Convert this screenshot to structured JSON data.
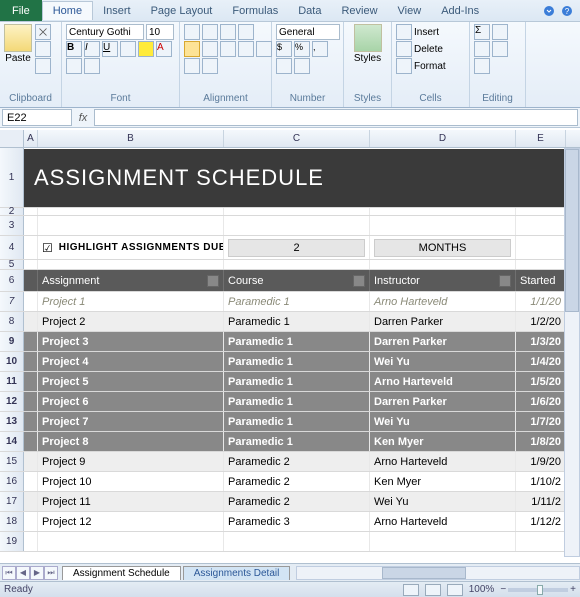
{
  "ribbon": {
    "file": "File",
    "tabs": [
      "Home",
      "Insert",
      "Page Layout",
      "Formulas",
      "Data",
      "Review",
      "View",
      "Add-Ins"
    ],
    "active_tab": "Home",
    "clipboard": {
      "label": "Clipboard",
      "paste": "Paste"
    },
    "font": {
      "label": "Font",
      "name": "Century Gothi",
      "size": "10"
    },
    "alignment": {
      "label": "Alignment"
    },
    "number": {
      "label": "Number",
      "format": "General"
    },
    "styles": {
      "label": "Styles"
    },
    "cells": {
      "label": "Cells",
      "insert": "Insert",
      "delete": "Delete",
      "format": "Format"
    },
    "editing": {
      "label": "Editing"
    }
  },
  "namebox": "E22",
  "fx": "fx",
  "columns": [
    "A",
    "B",
    "C",
    "D",
    "E"
  ],
  "row_numbers": [
    "1",
    "2",
    "3",
    "4",
    "5",
    "6",
    "7",
    "8",
    "9",
    "10",
    "11",
    "12",
    "13",
    "14",
    "15",
    "16",
    "17",
    "18",
    "19"
  ],
  "title": "ASSIGNMENT SCHEDULE",
  "highlight": {
    "checked": true,
    "label": "HIGHLIGHT ASSIGNMENTS DUE WITHIN",
    "value": "2",
    "unit": "MONTHS"
  },
  "table": {
    "headers": [
      "Assignment",
      "Course",
      "Instructor",
      "Started"
    ],
    "rows": [
      {
        "cells": [
          "Project 1",
          "Paramedic 1",
          "Arno Harteveld",
          "1/1/20"
        ],
        "style": "italic"
      },
      {
        "cells": [
          "Project 2",
          "Paramedic 1",
          "Darren Parker",
          "1/2/20"
        ],
        "style": "light"
      },
      {
        "cells": [
          "Project 3",
          "Paramedic 1",
          "Darren Parker",
          "1/3/20"
        ],
        "style": "gray"
      },
      {
        "cells": [
          "Project 4",
          "Paramedic 1",
          "Wei Yu",
          "1/4/20"
        ],
        "style": "gray"
      },
      {
        "cells": [
          "Project 5",
          "Paramedic 1",
          "Arno Harteveld",
          "1/5/20"
        ],
        "style": "gray"
      },
      {
        "cells": [
          "Project 6",
          "Paramedic 1",
          "Darren Parker",
          "1/6/20"
        ],
        "style": "gray"
      },
      {
        "cells": [
          "Project 7",
          "Paramedic 1",
          "Wei Yu",
          "1/7/20"
        ],
        "style": "gray"
      },
      {
        "cells": [
          "Project 8",
          "Paramedic 1",
          "Ken Myer",
          "1/8/20"
        ],
        "style": "gray"
      },
      {
        "cells": [
          "Project 9",
          "Paramedic 2",
          "Arno Harteveld",
          "1/9/20"
        ],
        "style": "light"
      },
      {
        "cells": [
          "Project 10",
          "Paramedic 2",
          "Ken Myer",
          "1/10/2"
        ],
        "style": "light-alt"
      },
      {
        "cells": [
          "Project 11",
          "Paramedic 2",
          "Wei Yu",
          "1/11/2"
        ],
        "style": "light"
      },
      {
        "cells": [
          "Project 12",
          "Paramedic 3",
          "Arno Harteveld",
          "1/12/2"
        ],
        "style": "light-alt"
      }
    ]
  },
  "sheets": {
    "active": "Assignment Schedule",
    "others": [
      "Assignments Detail"
    ]
  },
  "status": {
    "ready": "Ready",
    "zoom": "100%"
  }
}
